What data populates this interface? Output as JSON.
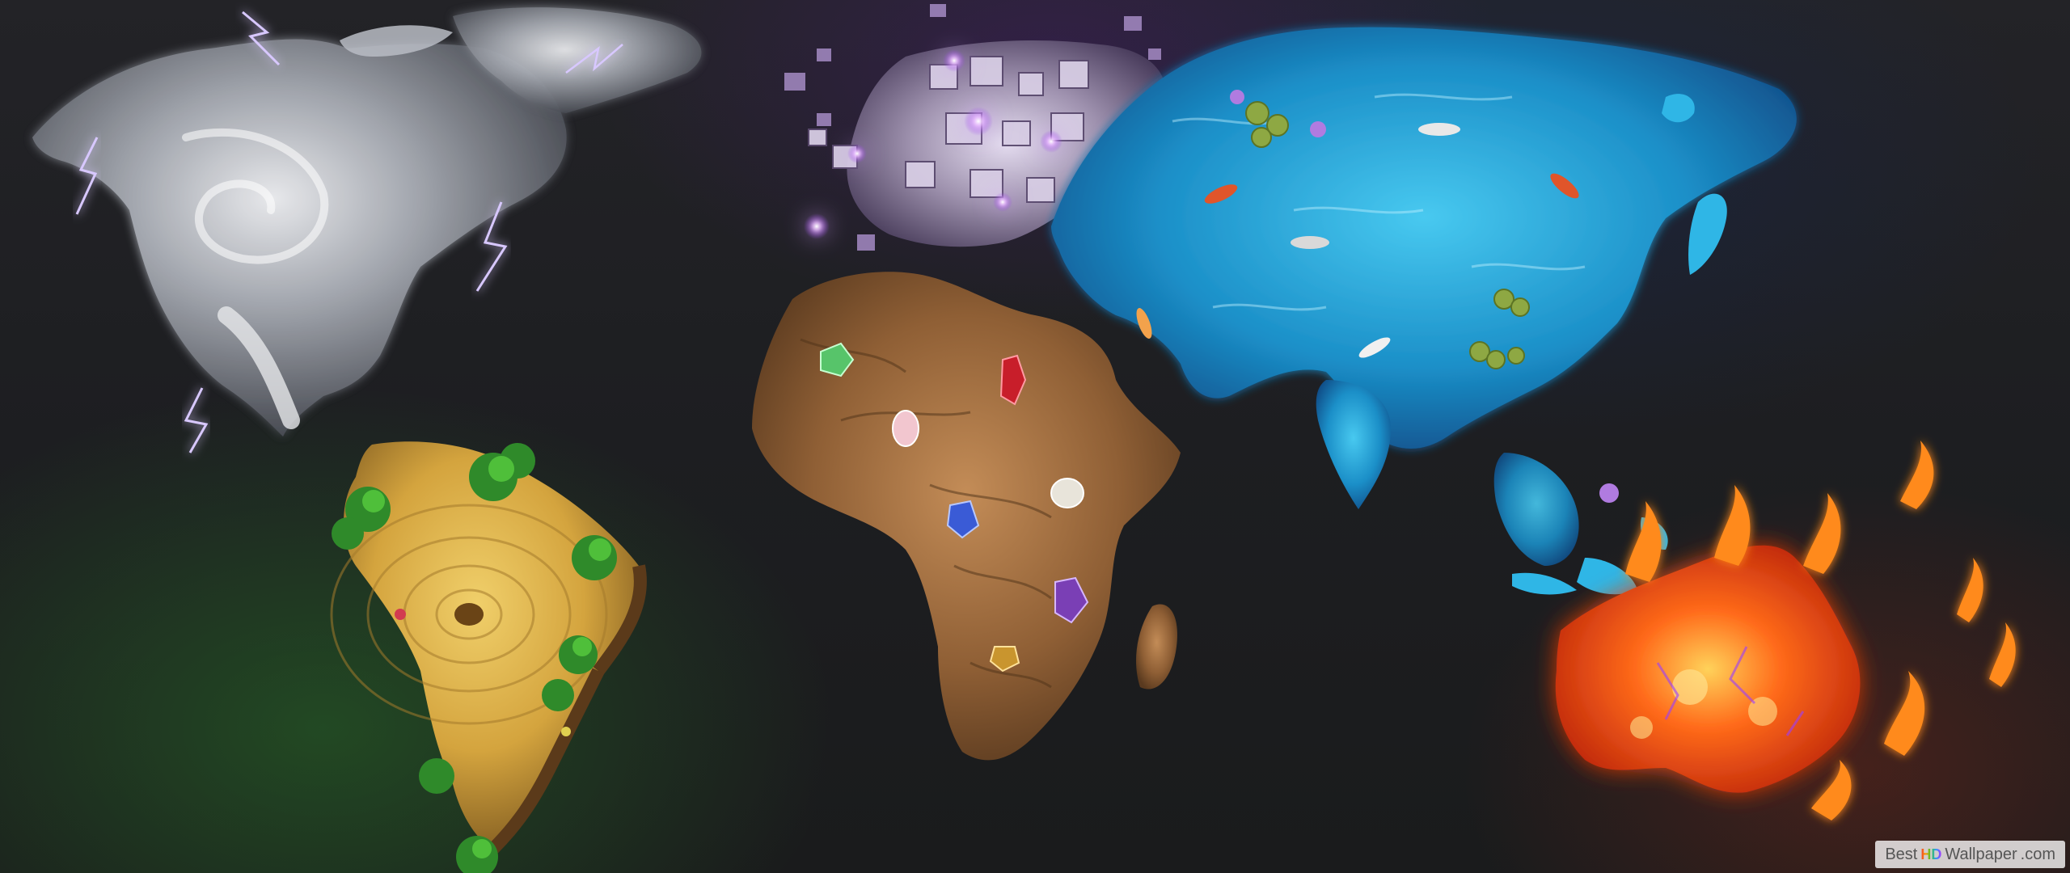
{
  "image": {
    "subject": "elemental world map wallpaper",
    "regions": [
      {
        "id": "north-america",
        "element": "storm"
      },
      {
        "id": "south-america",
        "element": "wood-and-jungle"
      },
      {
        "id": "europe",
        "element": "crystal-blocks"
      },
      {
        "id": "africa",
        "element": "earth-and-gems"
      },
      {
        "id": "asia",
        "element": "water"
      },
      {
        "id": "australia",
        "element": "fire"
      }
    ]
  },
  "watermark": {
    "best": "Best",
    "hd": "HD",
    "wallpaper": "Wallpaper",
    "suffix": ".com"
  },
  "colors": {
    "background": "#1d1e21",
    "storm": "#b9bcc4",
    "wood": "#d9b24a",
    "jungle": "#2f7a2a",
    "crystal": "#b7a6c8",
    "earth": "#9a6a3e",
    "water": "#27a6d9",
    "fire": "#ff5a14"
  }
}
